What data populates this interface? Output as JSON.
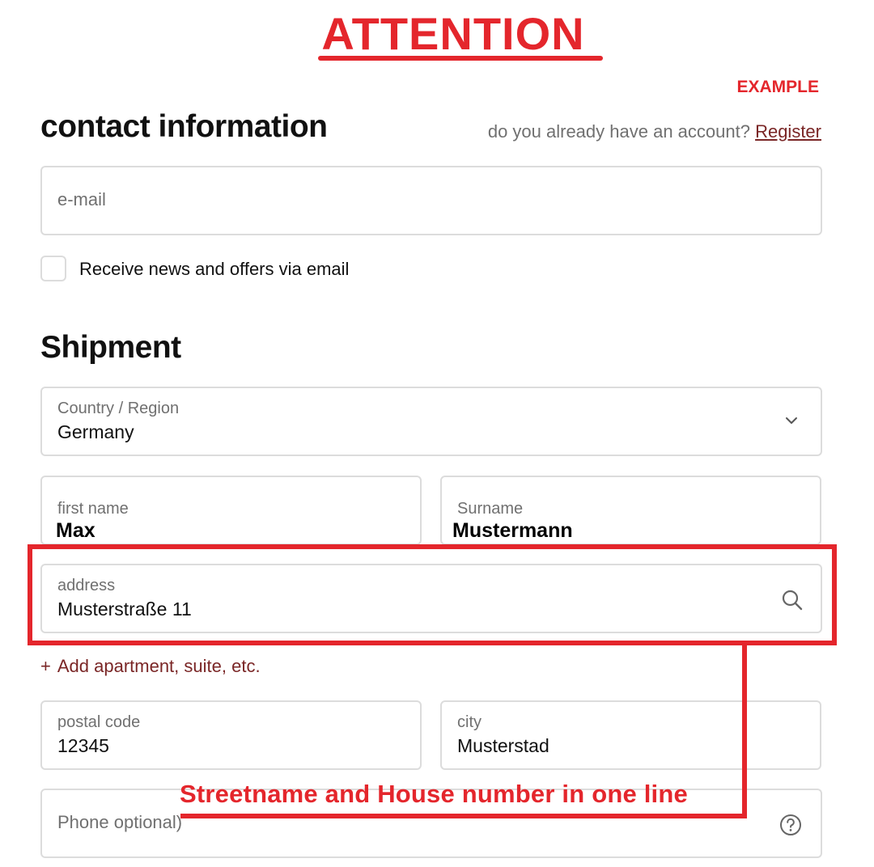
{
  "annotation": {
    "heading": "ATTENTION",
    "badge": "EXAMPLE",
    "note": "Streetname and House number in one line",
    "accent_color": "#e4262c"
  },
  "contact": {
    "title": "contact information",
    "account_prompt": "do you already have an account?",
    "register_link": "Register",
    "email_placeholder": "e-mail",
    "newsletter_checkbox_label": "Receive news and offers via email",
    "newsletter_checked": false
  },
  "shipment": {
    "title": "Shipment",
    "country": {
      "label": "Country / Region",
      "value": "Germany",
      "icon": "chevron-down-icon"
    },
    "first_name": {
      "label": "first name",
      "value": "Max"
    },
    "surname": {
      "label": "Surname",
      "value": "Mustermann"
    },
    "address": {
      "label": "address",
      "value": "Musterstraße 11",
      "icon": "search-icon"
    },
    "add_apartment": {
      "plus": "+",
      "label": "Add apartment, suite, etc."
    },
    "postal_code": {
      "label": "postal code",
      "value": "12345"
    },
    "city": {
      "label": "city",
      "value": "Musterstad"
    },
    "phone": {
      "placeholder": "Phone optional)",
      "icon": "help-icon"
    }
  },
  "colors": {
    "link": "#7a2626",
    "border": "#dcdcdc",
    "muted_text": "#707070"
  }
}
